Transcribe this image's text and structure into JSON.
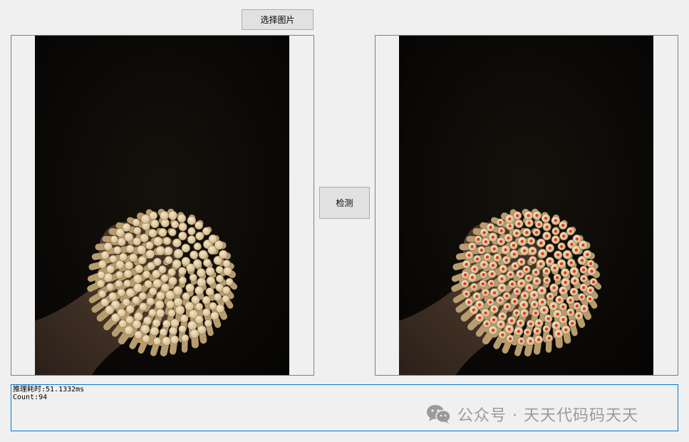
{
  "buttons": {
    "select_image": "选择图片",
    "detect": "检测"
  },
  "output": {
    "line1": "推理耗时:51.1332ms",
    "line2": "Count:94"
  },
  "watermark": {
    "text": "公众号 · 天天代码码天天",
    "icon": "wechat-icon"
  },
  "colors": {
    "window_bg": "#f0f0f0",
    "output_border": "#0078d7",
    "button_bg": "#e1e1e1",
    "detection_dot": "#e8361c"
  }
}
